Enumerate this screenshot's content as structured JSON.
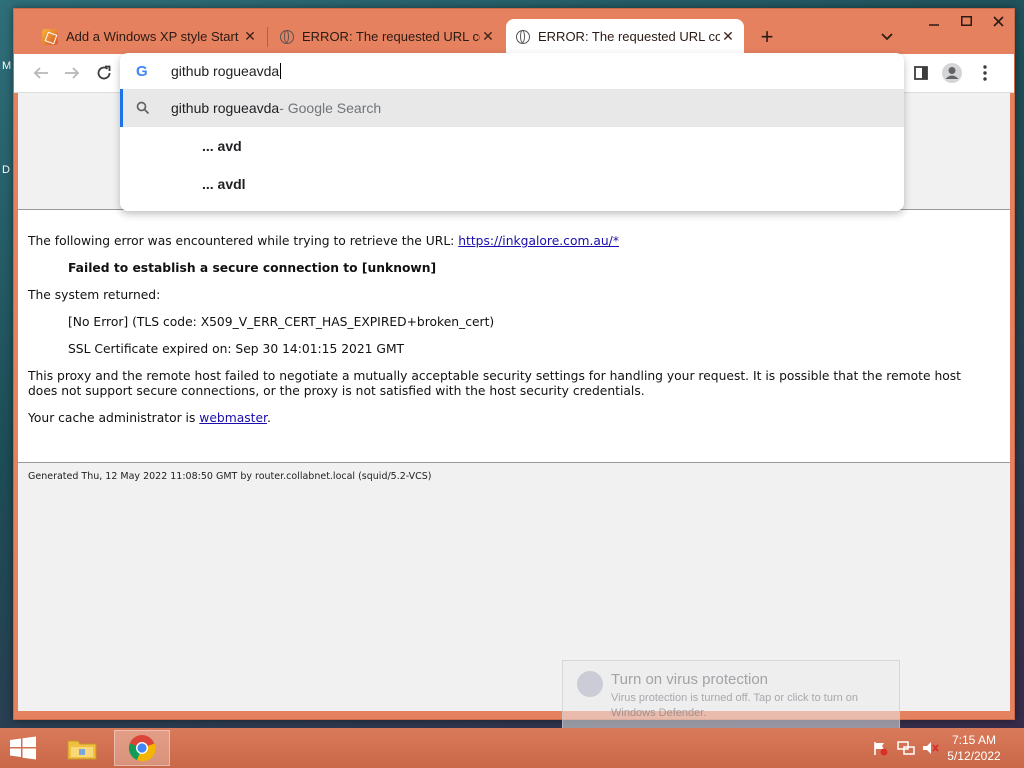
{
  "desktop": {
    "left_edge_labels": [
      "M",
      "D"
    ]
  },
  "browser": {
    "tabs": [
      {
        "title": "Add a Windows XP style Start Me",
        "favicon": "xp-favicon-icon",
        "active": false
      },
      {
        "title": "ERROR: The requested URL could",
        "favicon": "globe-icon",
        "active": false
      },
      {
        "title": "ERROR: The requested URL could",
        "favicon": "globe-icon",
        "active": true
      }
    ],
    "new_tab_label": "+",
    "omnibox": {
      "input_value": "github rogueavda",
      "suggestions": [
        {
          "text": "github rogueavda",
          "suffix": " - Google Search",
          "icon": "search-icon",
          "selected": true
        },
        {
          "text": "... avd",
          "suffix": "",
          "icon": "",
          "selected": false
        },
        {
          "text": "... avdl",
          "suffix": "",
          "icon": "",
          "selected": false
        }
      ]
    },
    "accent_color": "#e5815f"
  },
  "page": {
    "line1_prefix": "The following error was encountered while trying to retrieve the URL: ",
    "line1_url": "https://inkgalore.com.au/*",
    "error_heading": "Failed to establish a secure connection to [unknown]",
    "system_returned": "The system returned:",
    "no_error": "[No Error] (TLS code: X509_V_ERR_CERT_HAS_EXPIRED+broken_cert)",
    "ssl_expired": "SSL Certificate expired on: Sep 30 14:01:15 2021 GMT",
    "proxy_message": "This proxy and the remote host failed to negotiate a mutually acceptable security settings for handling your request. It is possible that the remote host does not support secure connections, or the proxy is not satisfied with the host security credentials.",
    "admin_prefix": "Your cache administrator is ",
    "admin_link": "webmaster",
    "admin_suffix": ".",
    "footer": "Generated Thu, 12 May 2022 11:08:50 GMT by router.collabnet.local (squid/5.2-VCS)"
  },
  "toast": {
    "title": "Turn on virus protection",
    "body": "Virus protection is turned off. Tap or click to turn on Windows Defender."
  },
  "taskbar": {
    "time": "7:15 AM",
    "date": "5/12/2022",
    "pinned": [
      "file-explorer-icon",
      "chrome-icon"
    ]
  }
}
